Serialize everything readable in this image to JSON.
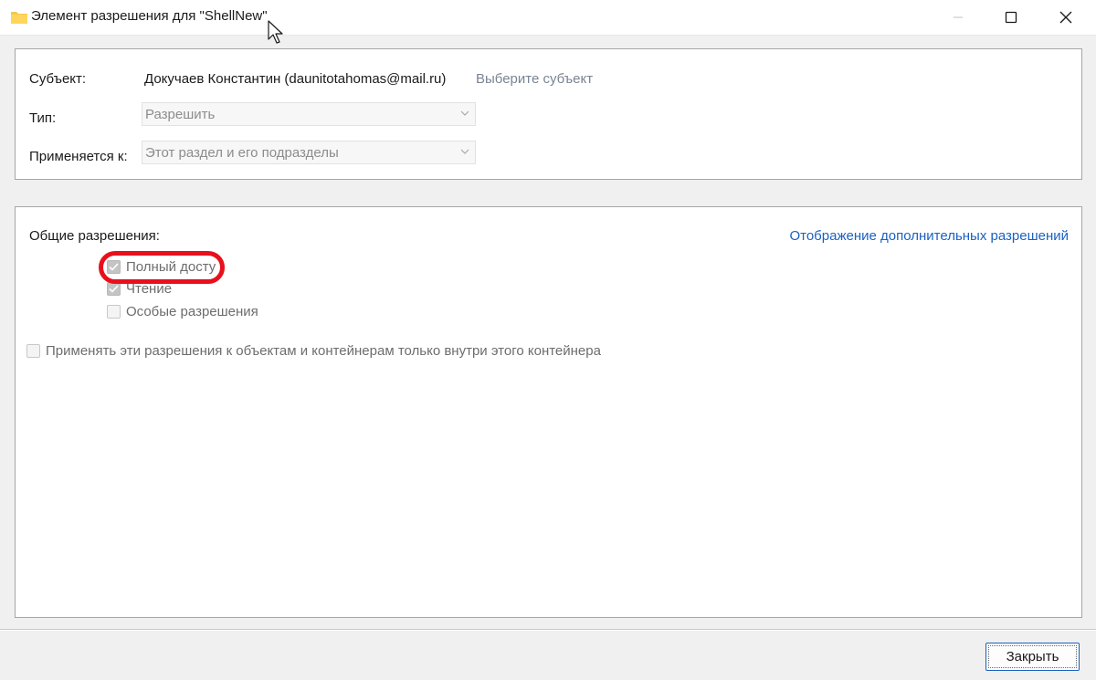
{
  "window": {
    "title": "Элемент разрешения для \"ShellNew\"",
    "folder_color": "#f2c94c"
  },
  "subject": {
    "label": "Субъект:",
    "value": "Докучаев Константин (daunitotahomas@mail.ru)",
    "select_link": "Выберите субъект"
  },
  "type": {
    "label": "Тип:",
    "value": "Разрешить"
  },
  "applies_to": {
    "label": "Применяется к:",
    "value": "Этот раздел и его подразделы"
  },
  "permissions": {
    "heading": "Общие разрешения:",
    "advanced_link": "Отображение дополнительных разрешений",
    "items": [
      {
        "label": "Полный досту",
        "checked": true
      },
      {
        "label": "Чтение",
        "checked": true
      },
      {
        "label": "Особые разрешения",
        "checked": false
      }
    ],
    "apply_inside": {
      "label": "Применять эти разрешения к объектам и контейнерам только внутри этого контейнера",
      "checked": false
    }
  },
  "footer": {
    "close_label": "Закрыть"
  },
  "colors": {
    "accent": "#1a61c2",
    "highlight": "#e8101c"
  }
}
